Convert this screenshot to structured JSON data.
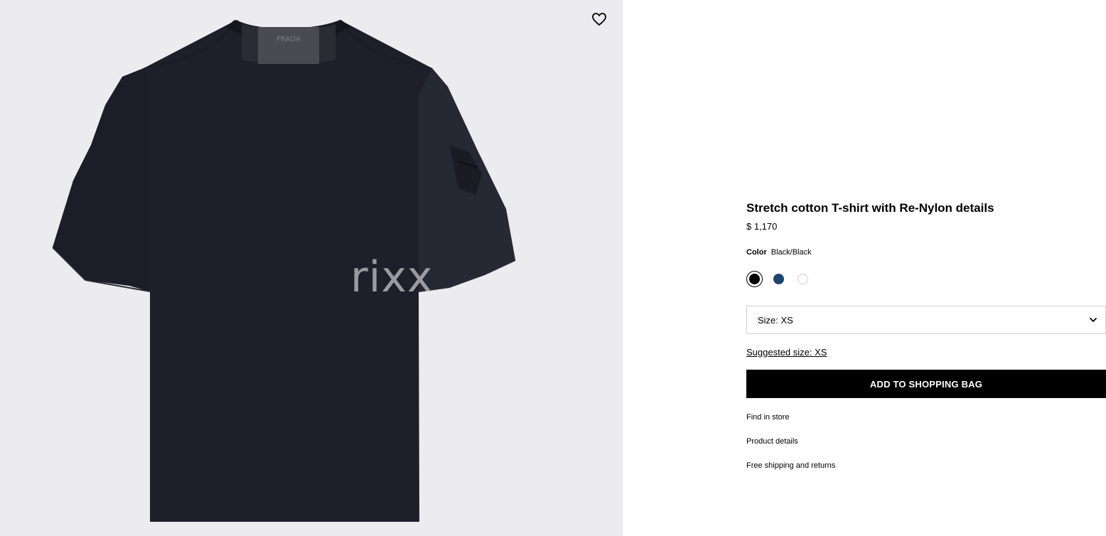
{
  "product": {
    "title": "Stretch cotton T-shirt with Re-Nylon details",
    "price": "$ 1,170",
    "color_label": "Color",
    "color_value": "Black/Black",
    "swatches": [
      {
        "name": "Black",
        "color": "#000000",
        "selected": true
      },
      {
        "name": "Navy",
        "color": "#1d4370",
        "selected": false
      },
      {
        "name": "White",
        "color": "#ffffff",
        "selected": false
      }
    ],
    "size_select": "Size: XS",
    "suggested_size": "Suggested size: XS",
    "add_to_bag_label": "ADD TO SHOPPING BAG",
    "links": [
      "Find in store",
      "Product details",
      "Free shipping and returns"
    ]
  },
  "gallery": {
    "background": "#ecebef",
    "garment_color": "#1e1f28",
    "label_text": "PRADA",
    "watermark": "rixx",
    "wishlist_icon": "heart-outline-icon"
  }
}
